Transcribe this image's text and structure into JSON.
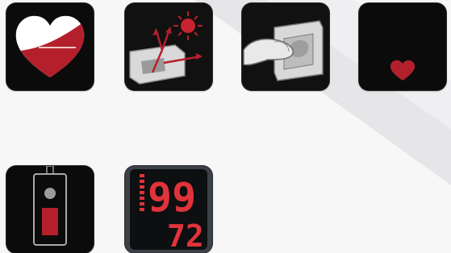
{
  "display": {
    "spo2_value": "99",
    "pulse_value": "72"
  },
  "colors": {
    "accent_red": "#b3202c",
    "bright_red": "#e0333a",
    "tile_bg": "#0b0b0c",
    "page_bg": "#f7f7f8"
  },
  "icons": [
    "heart-half-filled-icon",
    "sensor-light-reflection-icon",
    "finger-clip-icon",
    "small-heart-icon",
    "battery-level-icon",
    "spo2-pulse-readout-icon"
  ]
}
